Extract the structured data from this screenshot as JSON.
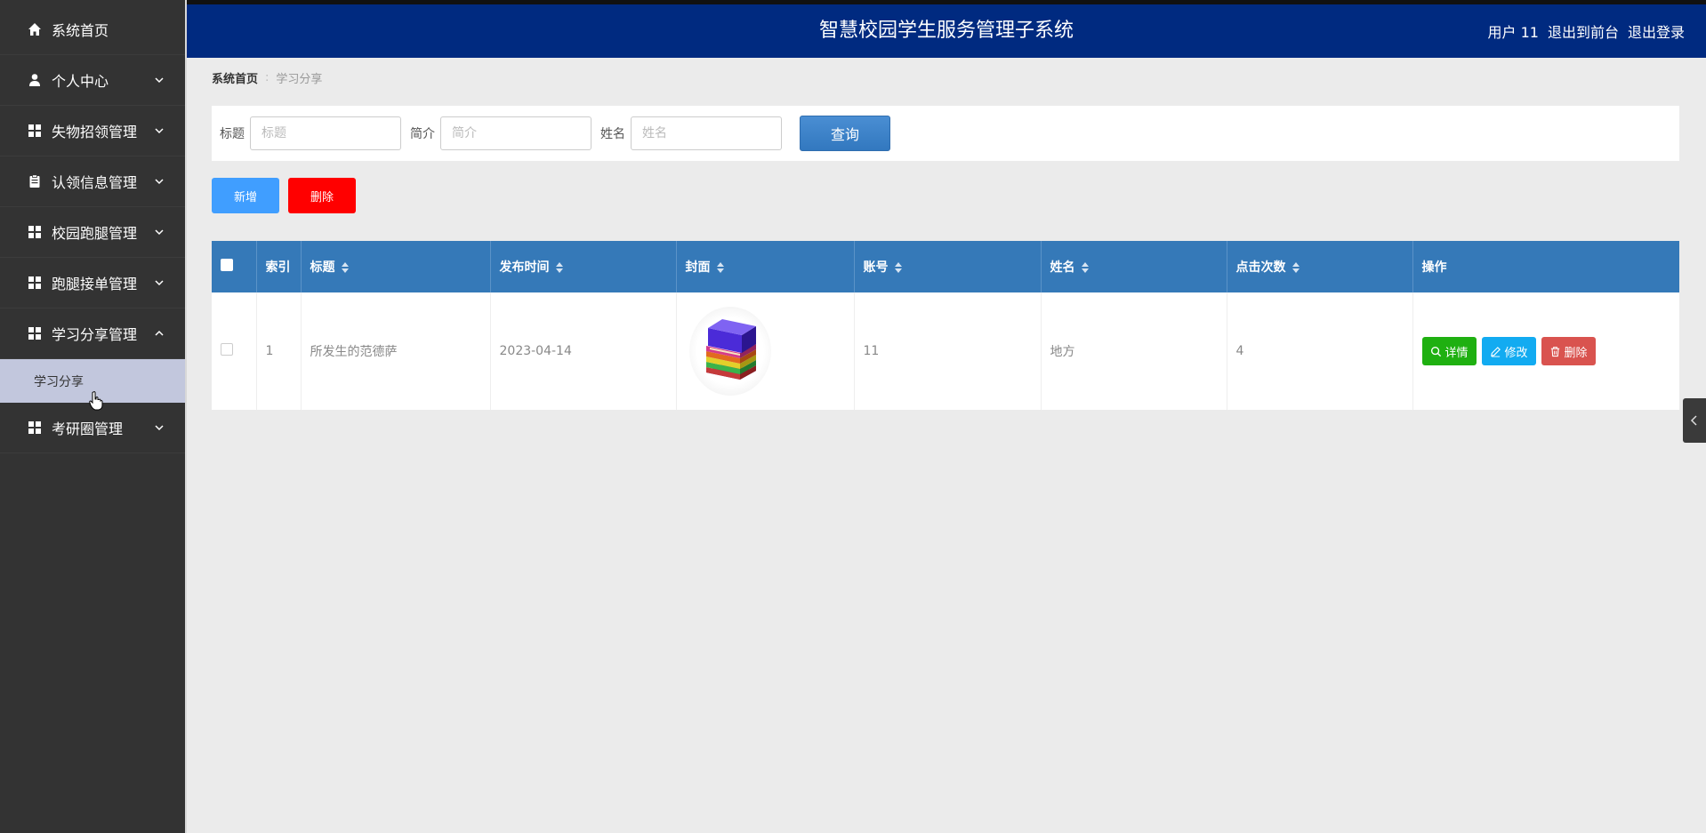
{
  "header": {
    "title": "智慧校园学生服务管理子系统",
    "user_label": "用户 11",
    "front_link": "退出到前台",
    "logout_link": "退出登录"
  },
  "sidebar": {
    "items": [
      {
        "label": "系统首页",
        "icon": "home-icon"
      },
      {
        "label": "个人中心",
        "icon": "user-icon"
      },
      {
        "label": "失物招领管理",
        "icon": "grid-icon"
      },
      {
        "label": "认领信息管理",
        "icon": "clipboard-icon"
      },
      {
        "label": "校园跑腿管理",
        "icon": "grid-icon"
      },
      {
        "label": "跑腿接单管理",
        "icon": "grid-icon"
      },
      {
        "label": "学习分享管理",
        "icon": "grid-icon"
      },
      {
        "label": "考研圈管理",
        "icon": "grid-icon"
      }
    ],
    "sub_item": "学习分享"
  },
  "breadcrumb": {
    "home": "系统首页",
    "separator": ":",
    "current": "学习分享"
  },
  "search": {
    "title_label": "标题",
    "title_placeholder": "标题",
    "intro_label": "简介",
    "intro_placeholder": "简介",
    "name_label": "姓名",
    "name_placeholder": "姓名",
    "query_button": "查询"
  },
  "actions": {
    "add": "新增",
    "delete": "删除"
  },
  "table": {
    "headers": [
      "索引",
      "标题",
      "发布时间",
      "封面",
      "账号",
      "姓名",
      "点击次数",
      "操作"
    ],
    "rows": [
      {
        "index": "1",
        "title": "所发生的范德萨",
        "publish_time": "2023-04-14",
        "cover": "books-icon",
        "account": "11",
        "name": "地方",
        "clicks": "4"
      }
    ],
    "ops": {
      "detail": "详情",
      "edit": "修改",
      "delete": "删除"
    }
  },
  "colors": {
    "header_bg": "#002a80",
    "sidebar_bg": "#333333",
    "table_head": "#3579b8",
    "add_button": "#409eff",
    "delete_button": "#ff0000",
    "detail": "#1fb011",
    "edit": "#12abf1",
    "row_delete": "#d9534f"
  }
}
